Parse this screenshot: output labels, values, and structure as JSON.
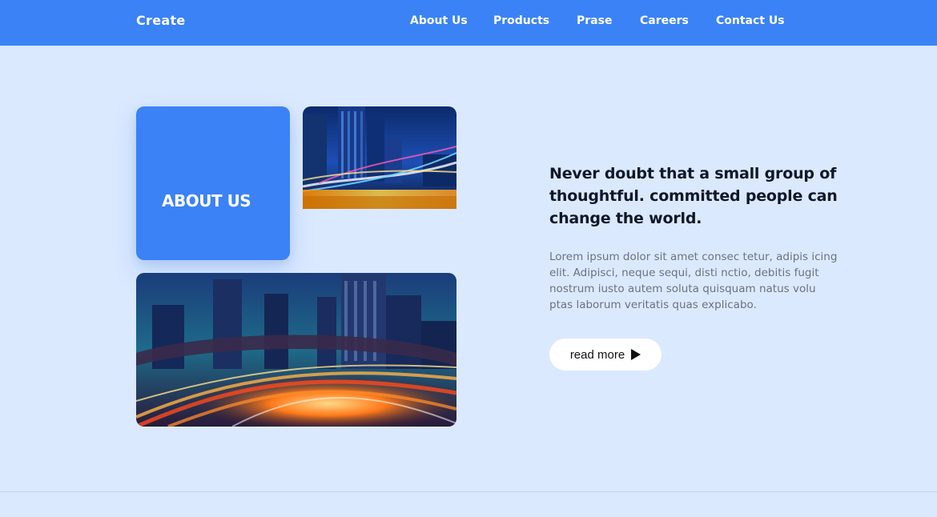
{
  "nav": {
    "brand": "Create",
    "links": [
      {
        "label": "About Us"
      },
      {
        "label": "Products"
      },
      {
        "label": "Prase"
      },
      {
        "label": "Careers"
      },
      {
        "label": "Contact Us"
      }
    ]
  },
  "about": {
    "card_title": "ABOUT US",
    "headline": "Never doubt that a small group of thoughtful. committed people can change the world.",
    "body": "Lorem ipsum dolor sit amet consec tetur, adipis icing elit. Adipisci, neque sequi, disti nctio, debitis fugit nostrum iusto autem soluta quisquam natus volu ptas laborum veritatis quas explicabo.",
    "cta_label": "read more"
  },
  "icons": {
    "cta_icon": "play-icon"
  },
  "colors": {
    "accent": "#3b82f6",
    "background": "#dbe9fe",
    "headline": "#0f172a",
    "body_text": "#6b7280"
  }
}
